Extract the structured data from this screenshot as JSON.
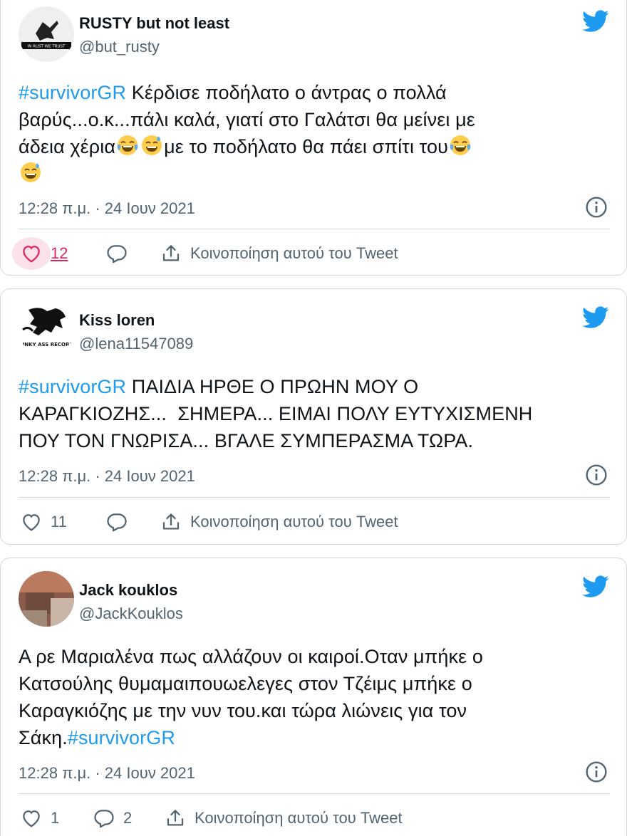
{
  "tweets": [
    {
      "name": "RUSTY but not least",
      "handle": "@but_rusty",
      "avatar_text": "IN RUST WE TRUST",
      "text_hashtag": "#survivorGR",
      "text_line1": " Κέρδισε ποδήλατο ο άντρας ο πολλά",
      "text_line2": "βαρύς...ο.κ...πάλι καλά, γιατί στο Γαλάτσι θα μείνει με",
      "text_line3a": "άδεια χέρια",
      "text_line3b": "με το ποδήλατο θα πάει σπίτι του",
      "timestamp": "12:28 π.μ. · 24 Ιουν 2021",
      "likes": "12",
      "replies": "",
      "share_label": "Κοινοποίηση αυτού του Tweet"
    },
    {
      "name": "Kiss loren",
      "handle": "@lena11547089",
      "avatar_text": "FUNKY ASS RECORDS",
      "text_hashtag": "#survivorGR",
      "text_line1": " ΠΑΙΔΙΑ ΗΡΘΕ Ο ΠΡΩΗΝ ΜΟΥ Ο",
      "text_line2": "ΚΑΡΑΓΚΙΟΖΗΣ...  ΣΗΜΕΡΑ... ΕΙΜΑΙ ΠΟΛΥ ΕΥΤΥΧΙΣΜΕΝΗ",
      "text_line3": "ΠΟΥ ΤΟΝ ΓΝΩΡΙΣΑ... ΒΓΑΛΕ ΣΥΜΠΕΡΑΣΜΑ ΤΩΡΑ.",
      "timestamp": "12:28 π.μ. · 24 Ιουν 2021",
      "likes": "11",
      "replies": "",
      "share_label": "Κοινοποίηση αυτού του Tweet"
    },
    {
      "name": "Jack kouklos",
      "handle": "@JackKouklos",
      "text_line1": "Α ρε Μαριαλένα πως αλλάζουν οι καιροί.Οταν μπήκε ο",
      "text_line2": "Κατσούλης θυμαμαιπουωελεγες στον Τζέιμς μπήκε ο",
      "text_line3": "Καραγκιόζης με την νυν του.και τώρα λιώνεις για τον",
      "text_line4": "Σάκη.",
      "text_hashtag": "#survivorGR",
      "timestamp": "12:28 π.μ. · 24 Ιουν 2021",
      "likes": "1",
      "replies": "2",
      "share_label": "Κοινοποίηση αυτού του Tweet"
    }
  ],
  "colors": {
    "accent": "#1d9bf0",
    "text": "#0f1419",
    "muted": "#536471",
    "border": "#cfd9de",
    "like": "#e0245e"
  },
  "icons": [
    "twitter-bird-icon",
    "info-icon",
    "heart-icon",
    "reply-icon",
    "share-icon",
    "laughing-tears-emoji",
    "sweat-smile-emoji"
  ]
}
